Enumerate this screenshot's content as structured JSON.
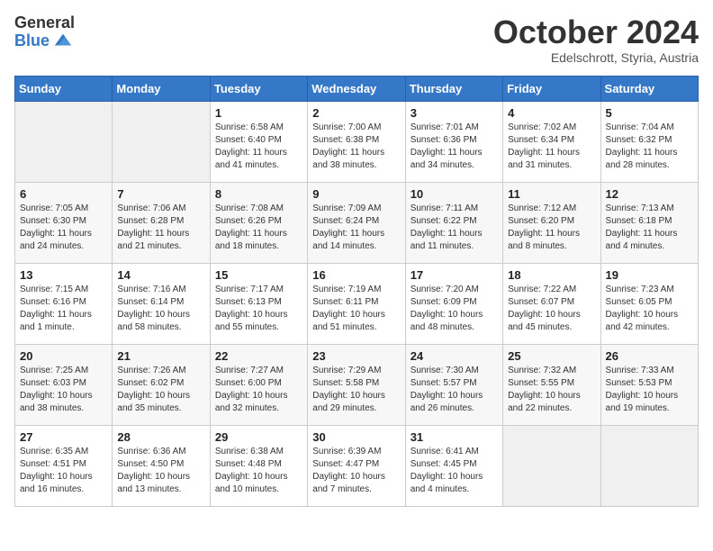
{
  "header": {
    "logo_general": "General",
    "logo_blue": "Blue",
    "month_title": "October 2024",
    "subtitle": "Edelschrott, Styria, Austria"
  },
  "weekdays": [
    "Sunday",
    "Monday",
    "Tuesday",
    "Wednesday",
    "Thursday",
    "Friday",
    "Saturday"
  ],
  "weeks": [
    [
      {
        "day": "",
        "sunrise": "",
        "sunset": "",
        "daylight": ""
      },
      {
        "day": "",
        "sunrise": "",
        "sunset": "",
        "daylight": ""
      },
      {
        "day": "1",
        "sunrise": "Sunrise: 6:58 AM",
        "sunset": "Sunset: 6:40 PM",
        "daylight": "Daylight: 11 hours and 41 minutes."
      },
      {
        "day": "2",
        "sunrise": "Sunrise: 7:00 AM",
        "sunset": "Sunset: 6:38 PM",
        "daylight": "Daylight: 11 hours and 38 minutes."
      },
      {
        "day": "3",
        "sunrise": "Sunrise: 7:01 AM",
        "sunset": "Sunset: 6:36 PM",
        "daylight": "Daylight: 11 hours and 34 minutes."
      },
      {
        "day": "4",
        "sunrise": "Sunrise: 7:02 AM",
        "sunset": "Sunset: 6:34 PM",
        "daylight": "Daylight: 11 hours and 31 minutes."
      },
      {
        "day": "5",
        "sunrise": "Sunrise: 7:04 AM",
        "sunset": "Sunset: 6:32 PM",
        "daylight": "Daylight: 11 hours and 28 minutes."
      }
    ],
    [
      {
        "day": "6",
        "sunrise": "Sunrise: 7:05 AM",
        "sunset": "Sunset: 6:30 PM",
        "daylight": "Daylight: 11 hours and 24 minutes."
      },
      {
        "day": "7",
        "sunrise": "Sunrise: 7:06 AM",
        "sunset": "Sunset: 6:28 PM",
        "daylight": "Daylight: 11 hours and 21 minutes."
      },
      {
        "day": "8",
        "sunrise": "Sunrise: 7:08 AM",
        "sunset": "Sunset: 6:26 PM",
        "daylight": "Daylight: 11 hours and 18 minutes."
      },
      {
        "day": "9",
        "sunrise": "Sunrise: 7:09 AM",
        "sunset": "Sunset: 6:24 PM",
        "daylight": "Daylight: 11 hours and 14 minutes."
      },
      {
        "day": "10",
        "sunrise": "Sunrise: 7:11 AM",
        "sunset": "Sunset: 6:22 PM",
        "daylight": "Daylight: 11 hours and 11 minutes."
      },
      {
        "day": "11",
        "sunrise": "Sunrise: 7:12 AM",
        "sunset": "Sunset: 6:20 PM",
        "daylight": "Daylight: 11 hours and 8 minutes."
      },
      {
        "day": "12",
        "sunrise": "Sunrise: 7:13 AM",
        "sunset": "Sunset: 6:18 PM",
        "daylight": "Daylight: 11 hours and 4 minutes."
      }
    ],
    [
      {
        "day": "13",
        "sunrise": "Sunrise: 7:15 AM",
        "sunset": "Sunset: 6:16 PM",
        "daylight": "Daylight: 11 hours and 1 minute."
      },
      {
        "day": "14",
        "sunrise": "Sunrise: 7:16 AM",
        "sunset": "Sunset: 6:14 PM",
        "daylight": "Daylight: 10 hours and 58 minutes."
      },
      {
        "day": "15",
        "sunrise": "Sunrise: 7:17 AM",
        "sunset": "Sunset: 6:13 PM",
        "daylight": "Daylight: 10 hours and 55 minutes."
      },
      {
        "day": "16",
        "sunrise": "Sunrise: 7:19 AM",
        "sunset": "Sunset: 6:11 PM",
        "daylight": "Daylight: 10 hours and 51 minutes."
      },
      {
        "day": "17",
        "sunrise": "Sunrise: 7:20 AM",
        "sunset": "Sunset: 6:09 PM",
        "daylight": "Daylight: 10 hours and 48 minutes."
      },
      {
        "day": "18",
        "sunrise": "Sunrise: 7:22 AM",
        "sunset": "Sunset: 6:07 PM",
        "daylight": "Daylight: 10 hours and 45 minutes."
      },
      {
        "day": "19",
        "sunrise": "Sunrise: 7:23 AM",
        "sunset": "Sunset: 6:05 PM",
        "daylight": "Daylight: 10 hours and 42 minutes."
      }
    ],
    [
      {
        "day": "20",
        "sunrise": "Sunrise: 7:25 AM",
        "sunset": "Sunset: 6:03 PM",
        "daylight": "Daylight: 10 hours and 38 minutes."
      },
      {
        "day": "21",
        "sunrise": "Sunrise: 7:26 AM",
        "sunset": "Sunset: 6:02 PM",
        "daylight": "Daylight: 10 hours and 35 minutes."
      },
      {
        "day": "22",
        "sunrise": "Sunrise: 7:27 AM",
        "sunset": "Sunset: 6:00 PM",
        "daylight": "Daylight: 10 hours and 32 minutes."
      },
      {
        "day": "23",
        "sunrise": "Sunrise: 7:29 AM",
        "sunset": "Sunset: 5:58 PM",
        "daylight": "Daylight: 10 hours and 29 minutes."
      },
      {
        "day": "24",
        "sunrise": "Sunrise: 7:30 AM",
        "sunset": "Sunset: 5:57 PM",
        "daylight": "Daylight: 10 hours and 26 minutes."
      },
      {
        "day": "25",
        "sunrise": "Sunrise: 7:32 AM",
        "sunset": "Sunset: 5:55 PM",
        "daylight": "Daylight: 10 hours and 22 minutes."
      },
      {
        "day": "26",
        "sunrise": "Sunrise: 7:33 AM",
        "sunset": "Sunset: 5:53 PM",
        "daylight": "Daylight: 10 hours and 19 minutes."
      }
    ],
    [
      {
        "day": "27",
        "sunrise": "Sunrise: 6:35 AM",
        "sunset": "Sunset: 4:51 PM",
        "daylight": "Daylight: 10 hours and 16 minutes."
      },
      {
        "day": "28",
        "sunrise": "Sunrise: 6:36 AM",
        "sunset": "Sunset: 4:50 PM",
        "daylight": "Daylight: 10 hours and 13 minutes."
      },
      {
        "day": "29",
        "sunrise": "Sunrise: 6:38 AM",
        "sunset": "Sunset: 4:48 PM",
        "daylight": "Daylight: 10 hours and 10 minutes."
      },
      {
        "day": "30",
        "sunrise": "Sunrise: 6:39 AM",
        "sunset": "Sunset: 4:47 PM",
        "daylight": "Daylight: 10 hours and 7 minutes."
      },
      {
        "day": "31",
        "sunrise": "Sunrise: 6:41 AM",
        "sunset": "Sunset: 4:45 PM",
        "daylight": "Daylight: 10 hours and 4 minutes."
      },
      {
        "day": "",
        "sunrise": "",
        "sunset": "",
        "daylight": ""
      },
      {
        "day": "",
        "sunrise": "",
        "sunset": "",
        "daylight": ""
      }
    ]
  ]
}
